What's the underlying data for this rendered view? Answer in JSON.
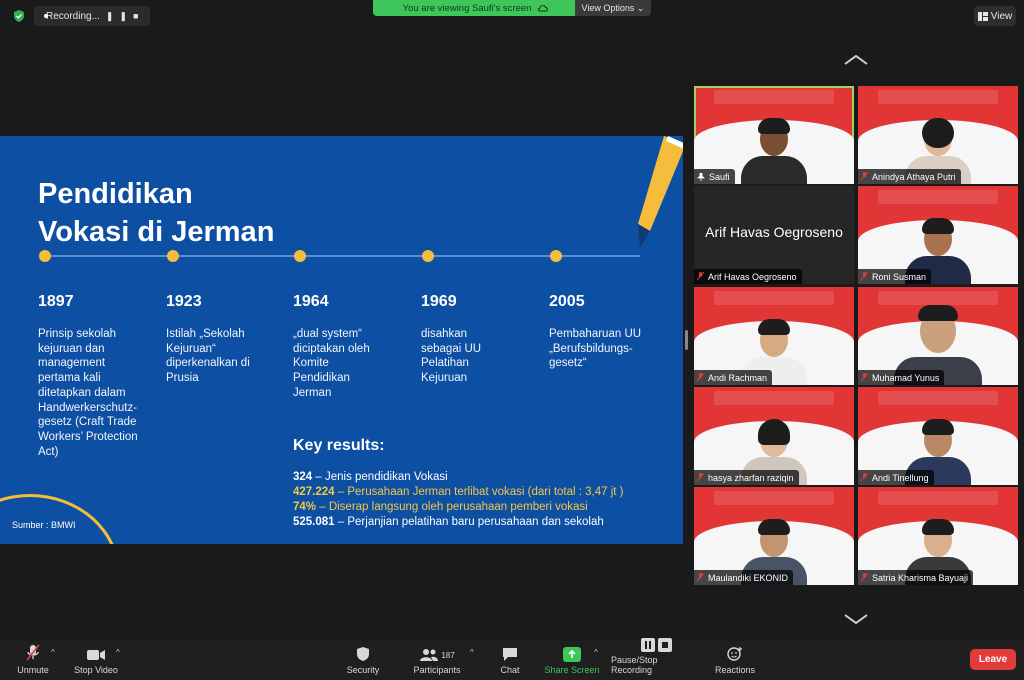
{
  "topbar": {
    "recording_label": "Recording...",
    "banner_text": "You are viewing Saufi's screen",
    "view_options_label": "View Options ⌄",
    "view_label": "View"
  },
  "slide": {
    "title_line1": "Pendidikan",
    "title_line2": "Vokasi di Jerman",
    "timeline": [
      {
        "year": "1897",
        "desc": "Prinsip sekolah kejuruan dan management pertama kali ditetapkan dalam Handwerkerschutz-gesetz (Craft Trade Workers’ Protection Act)"
      },
      {
        "year": "1923",
        "desc": "Istilah „Sekolah Kejuruan“ diperkenalkan di Prusia"
      },
      {
        "year": "1964",
        "desc": "„dual system“ diciptakan oleh Komite Pendidikan Jerman"
      },
      {
        "year": "1969",
        "desc": "disahkan sebagai UU Pelatihan Kejuruan"
      },
      {
        "year": "2005",
        "desc": "Pembaharuan UU „Berufsbildungs-gesetz“"
      }
    ],
    "key_results_title": "Key results:",
    "key_results": [
      {
        "num": "324",
        "text": " – Jenis pendidikan Vokasi",
        "color": "white"
      },
      {
        "num": "427.224",
        "text": " – Perusahaan Jerman terlibat vokasi (dari total : 3,47 jt )",
        "color": "yellow"
      },
      {
        "num": "74%",
        "text": " – Diserap langsung oleh perusahaan pemberi vokasi",
        "color": "yellow"
      },
      {
        "num": "525.081",
        "text": " – Perjanjian pelatihan baru perusahaan dan sekolah",
        "color": "white"
      }
    ],
    "source": "Sumber : BMWI"
  },
  "participants": [
    {
      "name": "Saufi",
      "pinned": true
    },
    {
      "name": "Anindya Athaya Putri"
    },
    {
      "name": "Arif Havas Oegroseno",
      "video_off": true
    },
    {
      "name": "Roni Susman"
    },
    {
      "name": "Andi Rachman"
    },
    {
      "name": "Muhamad Yunus"
    },
    {
      "name": "hasya zharfan raziqin"
    },
    {
      "name": "Andi Tinellung"
    },
    {
      "name": "Maulandiki EKONID"
    },
    {
      "name": "Satria Kharisma Bayuaji"
    }
  ],
  "toolbar": {
    "unmute": "Unmute",
    "stop_video": "Stop Video",
    "security": "Security",
    "participants": "Participants",
    "participants_count": "187",
    "chat": "Chat",
    "share_screen": "Share Screen",
    "pause_stop_recording": "Pause/Stop Recording",
    "reactions": "Reactions",
    "leave": "Leave"
  },
  "colors": {
    "slide_blue": "#0c4fa3",
    "accent_yellow": "#f5bd3b",
    "banner_green": "#3ec65a",
    "share_green": "#3ec65a",
    "leave_red": "#e23b3b",
    "tile_red": "#e23636"
  }
}
